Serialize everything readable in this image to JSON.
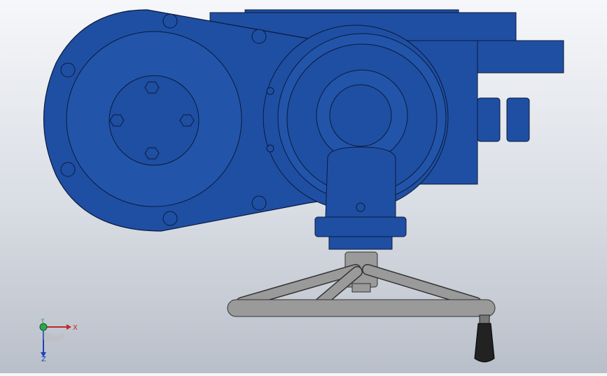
{
  "scene": {
    "kind": "3d-cad-viewport",
    "model_colors": {
      "housing": "#1f4fa3",
      "housing_dark": "#173c82",
      "outline": "#0b1a3a",
      "handwheel": "#8f8f8f",
      "knob": "#222222"
    }
  },
  "triad": {
    "x_label": "X",
    "y_label": "Y",
    "z_label": "Z",
    "x_color": "#c0272d",
    "y_color": "#2aa84a",
    "z_color": "#1f3fbf"
  }
}
